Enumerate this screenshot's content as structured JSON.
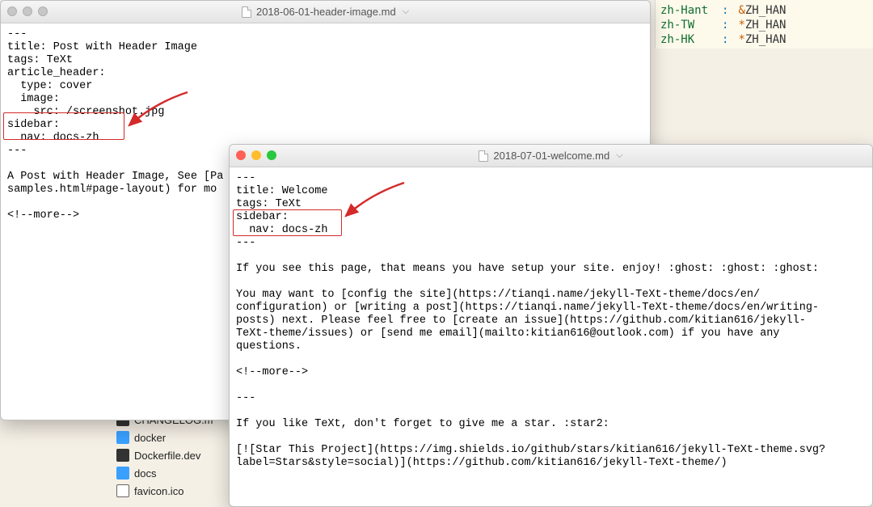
{
  "background_yaml": {
    "rows": [
      {
        "key": "zh-Hant",
        "sym": "&",
        "anchor": "ZH_HAN"
      },
      {
        "key": "zh-TW",
        "sym": "*",
        "anchor": "ZH_HAN"
      },
      {
        "key": "zh-HK",
        "sym": "*",
        "anchor": "ZH_HAN"
      }
    ],
    "colon": ":"
  },
  "win1": {
    "title": "2018-06-01-header-image.md",
    "dropdown": "⌵",
    "content_before": "---\ntitle: Post with Header Image\ntags: TeXt\narticle_header:\n  type: cover\n  image:\n    src: /screenshot.jpg",
    "highlight": "sidebar:\n  nav: docs-zh",
    "content_after": "---\n\nA Post with Header Image, See [Pa\nsamples.html#page-layout) for mo\n\n<!--more-->"
  },
  "win2": {
    "title": "2018-07-01-welcome.md",
    "dropdown": "⌵",
    "content_before": "---\ntitle: Welcome\ntags: TeXt",
    "highlight": "sidebar:\n  nav: docs-zh",
    "content_after": "---\n\nIf you see this page, that means you have setup your site. enjoy! :ghost: :ghost: :ghost:\n\nYou may want to [config the site](https://tianqi.name/jekyll-TeXt-theme/docs/en/\nconfiguration) or [writing a post](https://tianqi.name/jekyll-TeXt-theme/docs/en/writing-\nposts) next. Please feel free to [create an issue](https://github.com/kitian616/jekyll-\nTeXt-theme/issues) or [send me email](mailto:kitian616@outlook.com) if you have any\nquestions.\n\n<!--more-->\n\n---\n\nIf you like TeXt, don't forget to give me a star. :star2:\n\n[![Star This Project](https://img.shields.io/github/stars/kitian616/jekyll-TeXt-theme.svg?\nlabel=Stars&style=social)](https://github.com/kitian616/jekyll-TeXt-theme/)"
  },
  "file_list": {
    "rows": [
      {
        "icon": "dark",
        "name": "CHANGELOG.m"
      },
      {
        "icon": "folder",
        "name": "docker"
      },
      {
        "icon": "dark",
        "name": "Dockerfile.dev"
      },
      {
        "icon": "folder",
        "name": "docs"
      },
      {
        "icon": "bw",
        "name": "favicon.ico"
      }
    ]
  }
}
